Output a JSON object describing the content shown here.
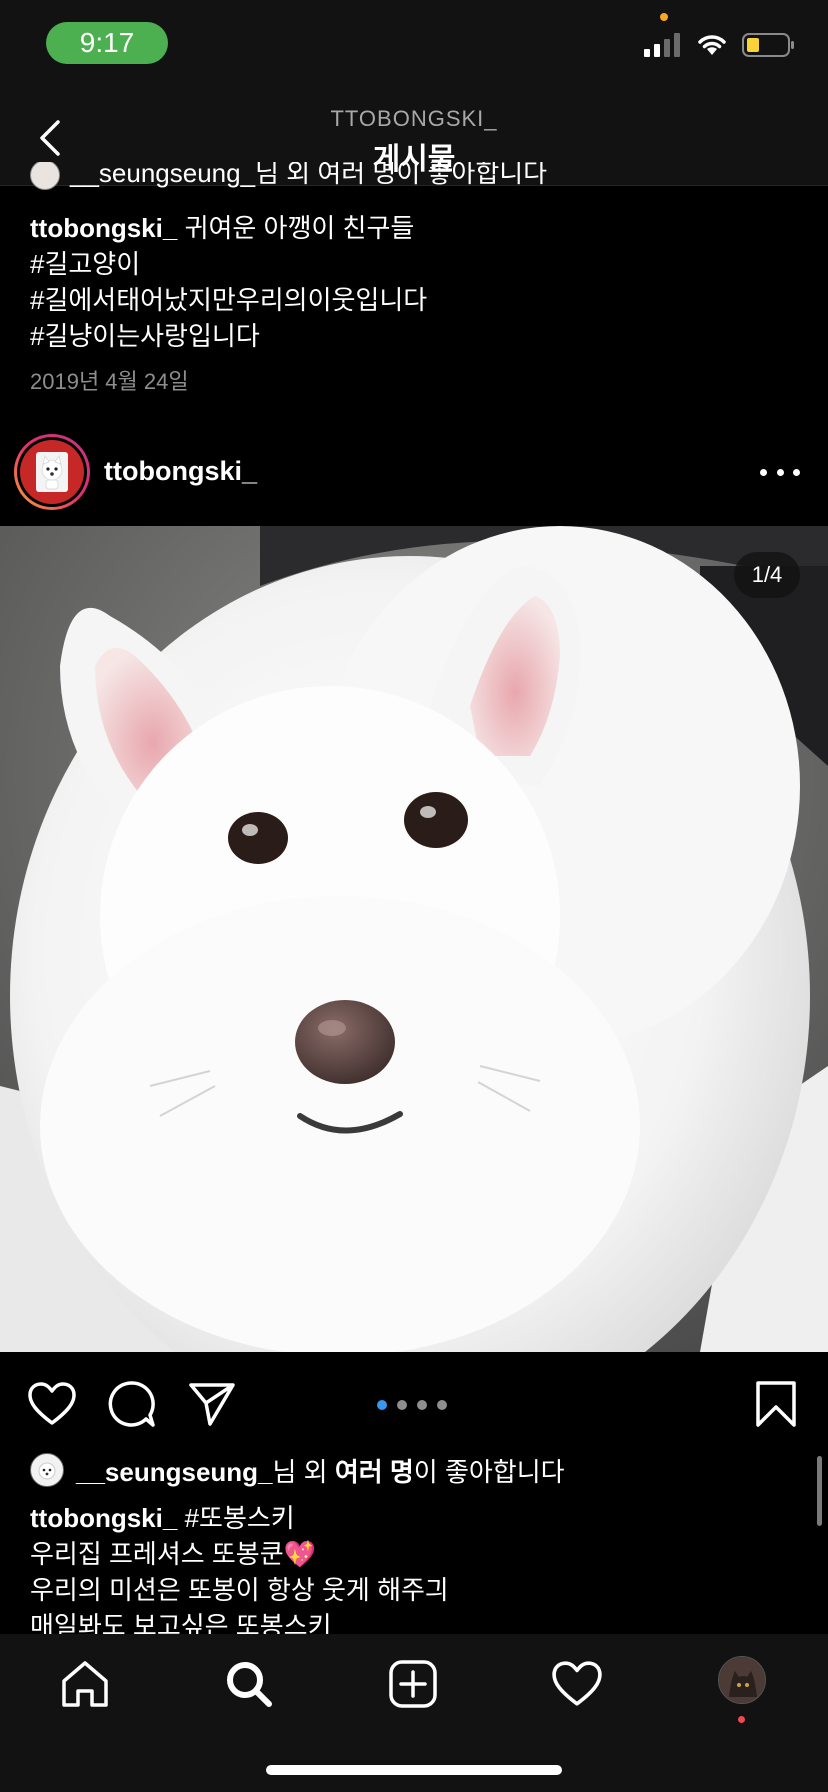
{
  "status_bar": {
    "time": "9:17",
    "battery_color": "#f8d33a",
    "time_pill_color": "#4caf50"
  },
  "header": {
    "username": "TTOBONGSKI_",
    "title": "게시물"
  },
  "previous_post": {
    "likes_partial": "__seungseung_님 외 여러 명이 좋아합니다",
    "caption_user": "ttobongski_",
    "caption_text": "귀여운 아깽이 친구들",
    "hashtags": [
      "#길고양이",
      "#길에서태어났지만우리의이웃입니다",
      "#길냥이는사랑입니다"
    ],
    "date": "2019년 4월 24일"
  },
  "post": {
    "username": "ttobongski_",
    "image_counter": "1/4",
    "carousel_count": 4,
    "carousel_active": 0,
    "likes": {
      "user": "__seungseung_",
      "middle": "님 외 ",
      "bold_part": "여러 명",
      "suffix": "이 좋아합니다"
    },
    "caption": {
      "user": "ttobongski_",
      "hashtag": "#또봉스키",
      "lines": [
        "우리집 프레셔스 또봉쿤💖",
        "우리의 미션은 또봉이 항상 웃게 해주긔",
        "매일봐도 보고싶은 또봉스키"
      ]
    }
  },
  "icons": {
    "actions": [
      "heart-icon",
      "comment-icon",
      "share-icon",
      "bookmark-icon"
    ],
    "tabs": [
      "home-icon",
      "search-icon",
      "add-icon",
      "activity-icon",
      "profile-icon"
    ]
  },
  "colors": {
    "accent": "#3897f0",
    "background": "#000000",
    "bar": "#121212",
    "secondary_text": "#8e8e8e",
    "notification": "#ed4956"
  }
}
